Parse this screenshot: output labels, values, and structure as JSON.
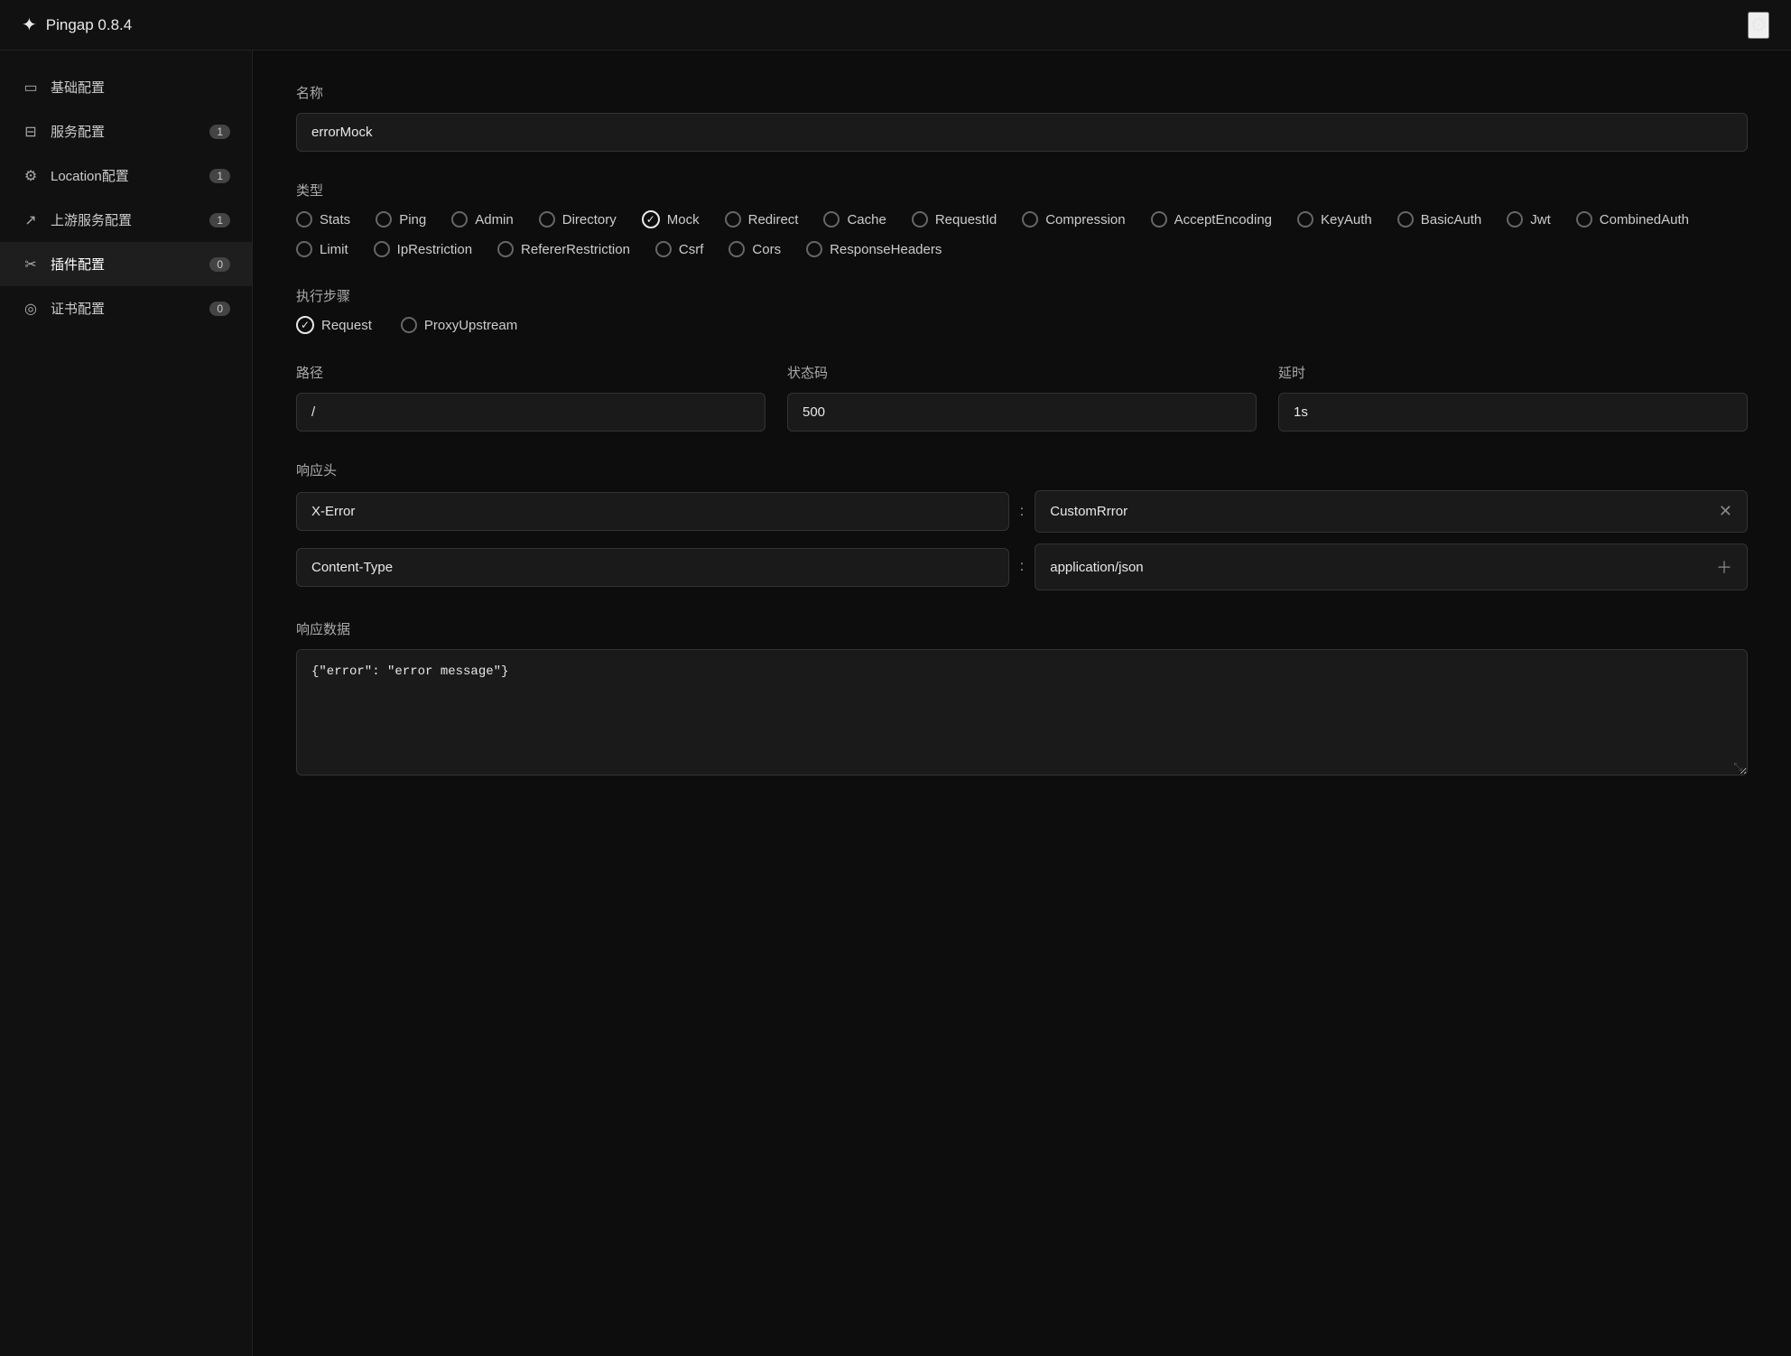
{
  "app": {
    "title": "Pingap  0.8.4",
    "icon": "✦",
    "settings_icon": "⚙"
  },
  "sidebar": {
    "items": [
      {
        "id": "basic",
        "icon": "▭",
        "label": "基础配置",
        "badge": null
      },
      {
        "id": "service",
        "icon": "⊟",
        "label": "服务配置",
        "badge": "1"
      },
      {
        "id": "location",
        "icon": "⚙",
        "label": "Location配置",
        "badge": "1"
      },
      {
        "id": "upstream",
        "icon": "↗",
        "label": "上游服务配置",
        "badge": "1"
      },
      {
        "id": "plugin",
        "icon": "✂",
        "label": "插件配置",
        "badge": "0",
        "active": true
      },
      {
        "id": "certificate",
        "icon": "◎",
        "label": "证书配置",
        "badge": "0"
      }
    ]
  },
  "form": {
    "name_label": "名称",
    "name_value": "errorMock",
    "type_label": "类型",
    "type_options": [
      {
        "id": "stats",
        "label": "Stats",
        "checked": false
      },
      {
        "id": "ping",
        "label": "Ping",
        "checked": false
      },
      {
        "id": "admin",
        "label": "Admin",
        "checked": false
      },
      {
        "id": "directory",
        "label": "Directory",
        "checked": false
      },
      {
        "id": "mock",
        "label": "Mock",
        "checked": true
      },
      {
        "id": "redirect",
        "label": "Redirect",
        "checked": false
      },
      {
        "id": "cache",
        "label": "Cache",
        "checked": false
      },
      {
        "id": "requestid",
        "label": "RequestId",
        "checked": false
      },
      {
        "id": "compression",
        "label": "Compression",
        "checked": false
      },
      {
        "id": "acceptencoding",
        "label": "AcceptEncoding",
        "checked": false
      },
      {
        "id": "keyauth",
        "label": "KeyAuth",
        "checked": false
      },
      {
        "id": "basicauth",
        "label": "BasicAuth",
        "checked": false
      },
      {
        "id": "jwt",
        "label": "Jwt",
        "checked": false
      },
      {
        "id": "combinedauth",
        "label": "CombinedAuth",
        "checked": false
      },
      {
        "id": "limit",
        "label": "Limit",
        "checked": false
      },
      {
        "id": "iprestriction",
        "label": "IpRestriction",
        "checked": false
      },
      {
        "id": "refererrestriction",
        "label": "RefererRestriction",
        "checked": false
      },
      {
        "id": "csrf",
        "label": "Csrf",
        "checked": false
      },
      {
        "id": "cors",
        "label": "Cors",
        "checked": false
      },
      {
        "id": "responseheaders",
        "label": "ResponseHeaders",
        "checked": false
      }
    ],
    "step_label": "执行步骤",
    "step_options": [
      {
        "id": "request",
        "label": "Request",
        "checked": true
      },
      {
        "id": "proxyupstream",
        "label": "ProxyUpstream",
        "checked": false
      }
    ],
    "path_label": "路径",
    "path_value": "/",
    "status_label": "状态码",
    "status_value": "500",
    "delay_label": "延时",
    "delay_value": "1s",
    "response_headers_label": "响应头",
    "response_headers": [
      {
        "key": "X-Error",
        "value": "CustomRrror"
      },
      {
        "key": "Content-Type",
        "value": "application/json"
      }
    ],
    "response_data_label": "响应数据",
    "response_data_value": "{\"error\": \"error message\"}"
  }
}
